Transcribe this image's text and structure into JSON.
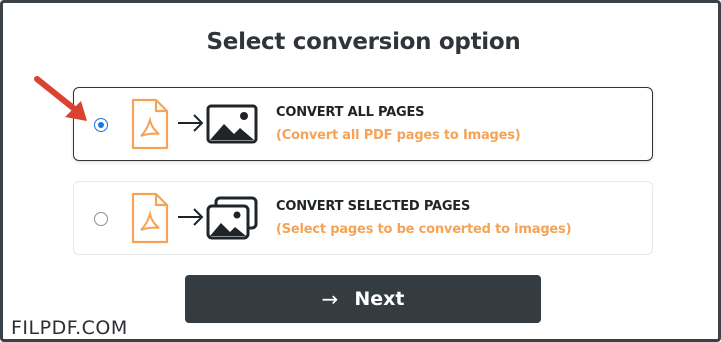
{
  "dialog": {
    "title": "Select conversion option"
  },
  "options": [
    {
      "title": "CONVERT ALL PAGES",
      "subtitle": "(Convert all PDF pages to Images)",
      "selected": true,
      "image_icon": "image-icon"
    },
    {
      "title": "CONVERT SELECTED PAGES",
      "subtitle": "(Select pages to be converted to images)",
      "selected": false,
      "image_icon": "images-stack-icon"
    }
  ],
  "next_button": {
    "label": "Next",
    "icon": "arrow-right-icon"
  },
  "watermark": "FILPDF.COM",
  "colors": {
    "accent": "#f5a356",
    "dark": "#343b41",
    "radio": "#1a73e8",
    "annotation_arrow": "#d9432f"
  }
}
